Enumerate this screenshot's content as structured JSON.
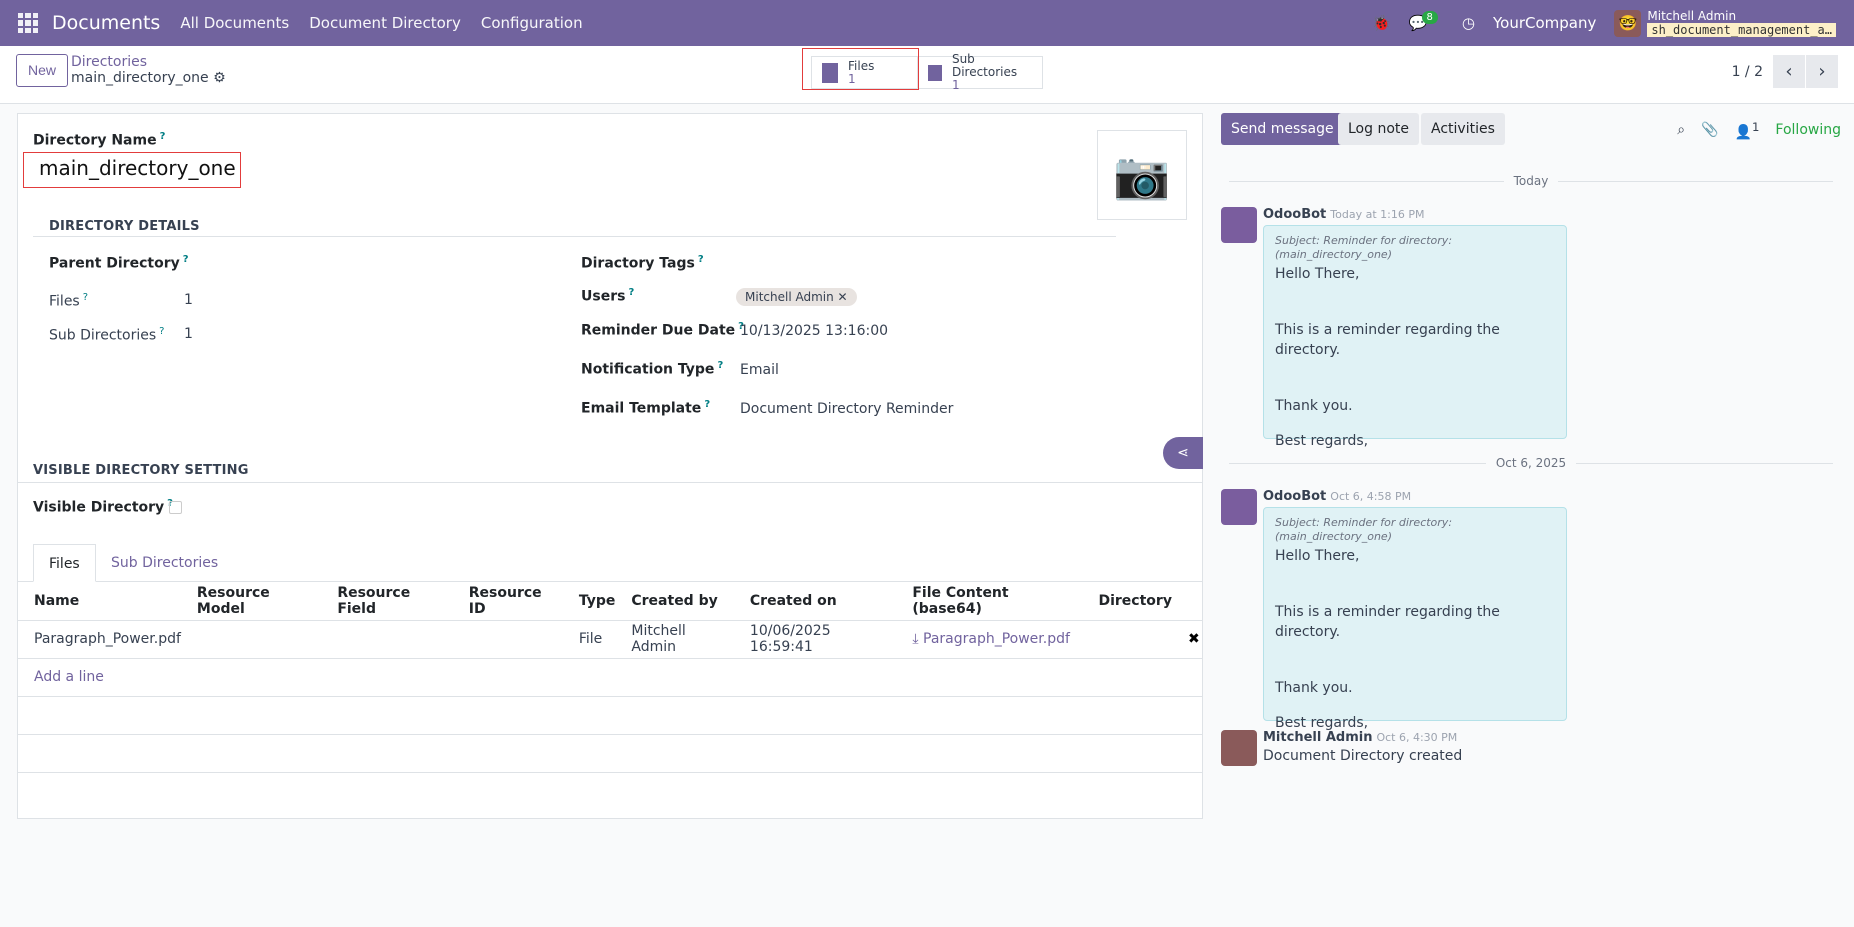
{
  "topbar": {
    "app": "Documents",
    "menus": [
      "All Documents",
      "Document Directory",
      "Configuration"
    ],
    "messages_count": "8",
    "company": "YourCompany",
    "user": "Mitchell Admin",
    "database": "sh_document_management_a…"
  },
  "control": {
    "new_label": "New",
    "breadcrumb_parent": "Directories",
    "breadcrumb_current": "main_directory_one",
    "stats": [
      {
        "label": "Files",
        "value": "1"
      },
      {
        "label": "Sub Directories",
        "value": "1"
      }
    ],
    "pager": "1 / 2"
  },
  "form": {
    "name_label": "Directory Name",
    "name_value": "main_directory_one",
    "section1": "DIRECTORY DETAILS",
    "parent_label": "Parent Directory",
    "files_label": "Files",
    "files_value": "1",
    "subdirs_label": "Sub Directories",
    "subdirs_value": "1",
    "tags_label": "Diractory Tags",
    "users_label": "Users",
    "user_tag": "Mitchell Admin",
    "due_label": "Reminder Due Date",
    "due_value": "10/13/2025 13:16:00",
    "notif_label": "Notification Type",
    "notif_value": "Email",
    "template_label": "Email Template",
    "template_value": "Document Directory Reminder",
    "section2": "VISIBLE DIRECTORY SETTING",
    "visible_label": "Visible Directory",
    "visible_checked": false
  },
  "tabs": [
    "Files",
    "Sub Directories"
  ],
  "table": {
    "columns": [
      "Name",
      "Resource Model",
      "Resource Field",
      "Resource ID",
      "Type",
      "Created by",
      "Created on",
      "File Content (base64)",
      "Directory"
    ],
    "rows": [
      {
        "name": "Paragraph_Power.pdf",
        "model": "",
        "field": "",
        "id": "",
        "type": "File",
        "created_by": "Mitchell Admin",
        "created_on": "10/06/2025 16:59:41",
        "content": "Paragraph_Power.pdf",
        "directory": ""
      }
    ],
    "add_line": "Add a line"
  },
  "chatter": {
    "send": "Send message",
    "log": "Log note",
    "activities": "Activities",
    "followers": "1",
    "following": "Following",
    "sep1": "Today",
    "sep2": "Oct 6, 2025",
    "messages": [
      {
        "author": "OdooBot",
        "time": "Today at 1:16 PM",
        "subject": "Subject: Reminder for directory: (main_directory_one)",
        "l1": "Hello There,",
        "l2": "This is a reminder regarding the directory.",
        "l3": "Thank you.",
        "l4": "Best regards,"
      },
      {
        "author": "OdooBot",
        "time": "Oct 6, 4:58 PM",
        "subject": "Subject: Reminder for directory: (main_directory_one)",
        "l1": "Hello There,",
        "l2": "This is a reminder regarding the directory.",
        "l3": "Thank you.",
        "l4": "Best regards,"
      },
      {
        "author": "Mitchell Admin",
        "time": "Oct 6, 4:30 PM",
        "body": "Document Directory created"
      }
    ]
  }
}
